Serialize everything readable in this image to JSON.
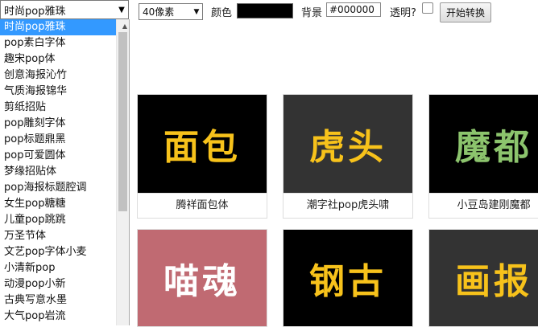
{
  "toolbar": {
    "font_selected": "时尚pop雅珠",
    "size_selected": "40像素",
    "color_label": "颜色",
    "color_value": "#000000",
    "bg_label": "背景",
    "bg_value": "#000000",
    "transparent_label": "透明?",
    "transparent_checked": false,
    "convert_label": "开始转换"
  },
  "font_list": [
    "时尚pop雅珠",
    "pop素白字体",
    "趣宋pop体",
    "创意海报沁竹",
    "气质海报锦华",
    "剪纸招贴",
    "pop雕刻字体",
    "pop标题鼎黑",
    "pop可爱圆体",
    "梦缘招贴体",
    "pop海报标题腔调",
    "女生pop糖糖",
    "儿童pop跳跳",
    "万圣节体",
    "文艺pop字体小麦",
    "小清新pop",
    "动漫pop小新",
    "古典写意水墨",
    "大气pop岩流"
  ],
  "cards": [
    {
      "preview": "面包",
      "caption": "腾祥面包体",
      "bg": "#000000",
      "fg": "#f7c21b"
    },
    {
      "preview": "虎头",
      "caption": "潮字社pop虎头啸",
      "bg": "#333333",
      "fg": "#f7c21b"
    },
    {
      "preview": "魔都",
      "caption": "小豆岛建刚魔都",
      "bg": "#000000",
      "fg": "#8cc46d"
    },
    {
      "preview": "喵魂",
      "caption": "",
      "bg": "#c06a72",
      "fg": "#ffffff"
    },
    {
      "preview": "钢古",
      "caption": "",
      "bg": "#000000",
      "fg": "#f7c21b"
    },
    {
      "preview": "画报",
      "caption": "",
      "bg": "#333333",
      "fg": "#f7c21b"
    }
  ]
}
